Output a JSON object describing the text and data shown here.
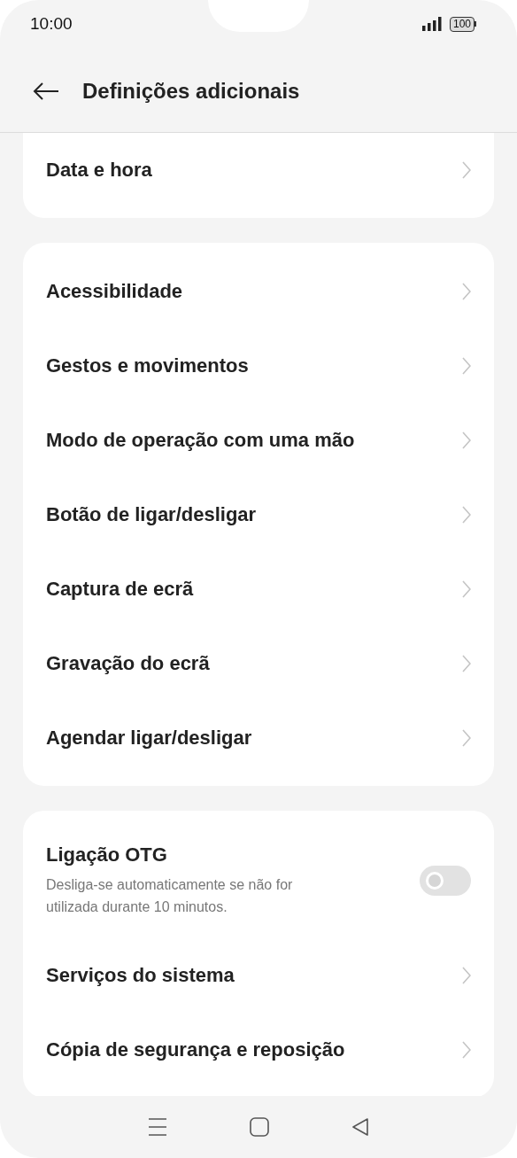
{
  "status_bar": {
    "time": "10:00",
    "battery": "100"
  },
  "header": {
    "title": "Definições adicionais"
  },
  "groups": [
    {
      "items": [
        {
          "kind": "link",
          "title": "Data e hora"
        }
      ]
    },
    {
      "items": [
        {
          "kind": "link",
          "title": "Acessibilidade"
        },
        {
          "kind": "link",
          "title": "Gestos e movimentos"
        },
        {
          "kind": "link",
          "title": "Modo de operação com uma mão"
        },
        {
          "kind": "link",
          "title": "Botão de ligar/desligar"
        },
        {
          "kind": "link",
          "title": "Captura de ecrã"
        },
        {
          "kind": "link",
          "title": "Gravação do ecrã"
        },
        {
          "kind": "link",
          "title": "Agendar ligar/desligar"
        }
      ]
    },
    {
      "items": [
        {
          "kind": "toggle",
          "title": "Ligação OTG",
          "subtitle": "Desliga-se automaticamente se não for utilizada durante 10 minutos.",
          "on": false
        },
        {
          "kind": "link",
          "title": "Serviços do sistema"
        },
        {
          "kind": "link",
          "title": "Cópia de segurança e reposição"
        }
      ]
    }
  ]
}
